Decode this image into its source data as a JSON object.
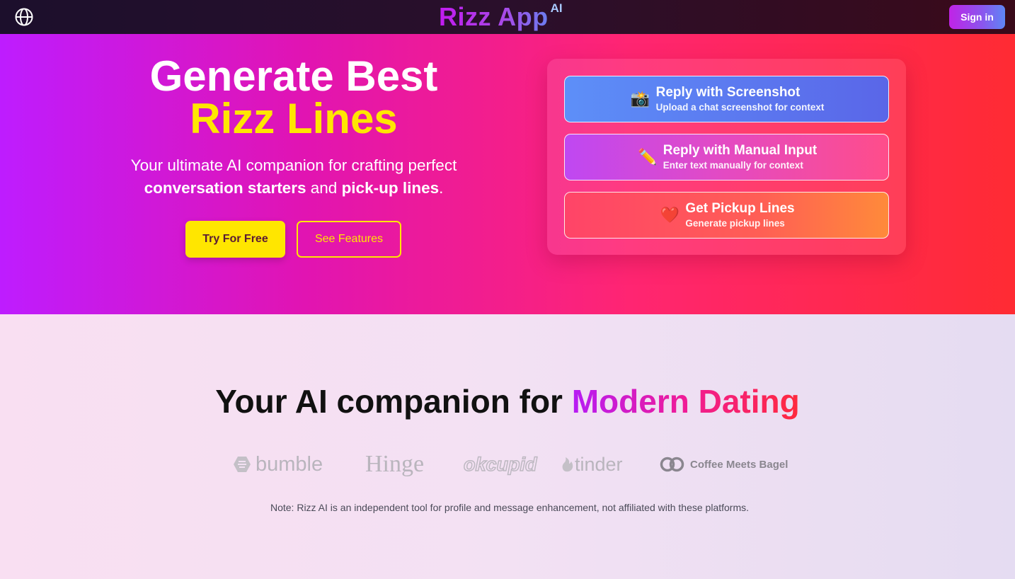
{
  "header": {
    "brand": "Rizz App",
    "brand_sup": "AI",
    "signin_label": "Sign in",
    "language_icon": "globe-icon"
  },
  "hero": {
    "title_line1": "Generate Best",
    "title_line2": "Rizz Lines",
    "sub_line1": "Your ultimate AI companion for crafting perfect",
    "sub_bold1": "conversation starters",
    "sub_and": "and",
    "sub_bold2": "pick-up lines",
    "sub_end": ".",
    "try_label": "Try For Free",
    "see_label": "See Features"
  },
  "options": [
    {
      "icon": "📸",
      "icon_name": "camera-icon",
      "title": "Reply with Screenshot",
      "desc": "Upload a chat screenshot for context"
    },
    {
      "icon": "✏️",
      "icon_name": "pencil-icon",
      "title": "Reply with Manual Input",
      "desc": "Enter text manually for context"
    },
    {
      "icon": "❤️",
      "icon_name": "heart-icon",
      "title": "Get Pickup Lines",
      "desc": "Generate pickup lines"
    }
  ],
  "companion": {
    "title_plain": "Your AI companion for",
    "title_grad": "Modern Dating",
    "logos": [
      "bumble",
      "Hinge",
      "okcupid",
      "tinder",
      "Coffee Meets Bagel"
    ],
    "note": "Note: Rizz AI is an independent tool for profile and message enhancement, not affiliated with these platforms."
  },
  "colors": {
    "accent_yellow": "#ffe600",
    "hero_start": "#be1cff",
    "hero_end": "#ff2b33"
  }
}
